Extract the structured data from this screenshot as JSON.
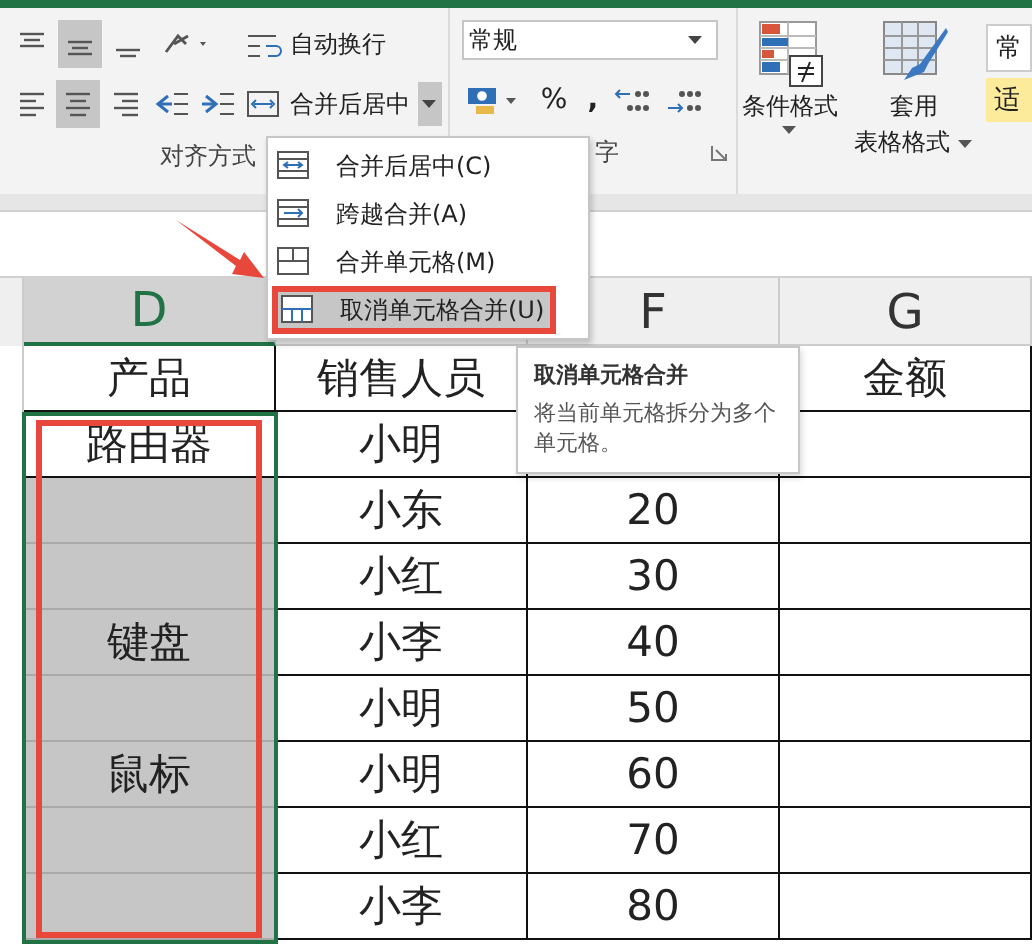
{
  "ribbon": {
    "alignment": {
      "label": "对齐方式",
      "vertical_align": [
        {
          "selected": false
        },
        {
          "selected": true
        },
        {
          "selected": false
        }
      ],
      "horizontal_align": [
        {
          "selected": false
        },
        {
          "selected": true
        },
        {
          "selected": false
        }
      ],
      "wrap_text": "自动换行",
      "merge": "合并后居中"
    },
    "number": {
      "label": "字",
      "format": "常规",
      "percent": "%",
      "comma": ","
    },
    "styles": {
      "conditional": "条件格式",
      "table_format": [
        "套用",
        "表格格式"
      ],
      "cell_styles": [
        "常",
        "适"
      ]
    }
  },
  "merge_menu": [
    {
      "label": "合并后居中(C)",
      "kind": "center",
      "selected": false
    },
    {
      "label": "跨越合并(A)",
      "kind": "across",
      "selected": false
    },
    {
      "label": "合并单元格(M)",
      "kind": "merge",
      "selected": false
    },
    {
      "label": "取消单元格合并(U)",
      "kind": "unmerge",
      "selected": true
    }
  ],
  "tooltip": {
    "title": "取消单元格合并",
    "body": "将当前单元格拆分为多个单元格。"
  },
  "columns": [
    {
      "label": "D",
      "selected": true
    },
    {
      "selected": false
    },
    {
      "label": "F",
      "selected": false
    },
    {
      "label": "G",
      "selected": false
    }
  ],
  "rows": [
    {
      "product": "产品",
      "seller": "销售人员",
      "amount": "金额",
      "selected": false
    },
    {
      "product": "路由器",
      "seller": "小明",
      "selected": false
    },
    {
      "seller": "小东",
      "quantity": "20",
      "selected": true
    },
    {
      "seller": "小红",
      "quantity": "30",
      "selected": true
    },
    {
      "product": "键盘",
      "seller": "小李",
      "quantity": "40",
      "selected": true
    },
    {
      "seller": "小明",
      "quantity": "50",
      "selected": true
    },
    {
      "product": "鼠标",
      "seller": "小明",
      "quantity": "60",
      "selected": true
    },
    {
      "seller": "小红",
      "quantity": "70",
      "selected": true
    },
    {
      "seller": "小李",
      "quantity": "80",
      "selected": true
    }
  ]
}
